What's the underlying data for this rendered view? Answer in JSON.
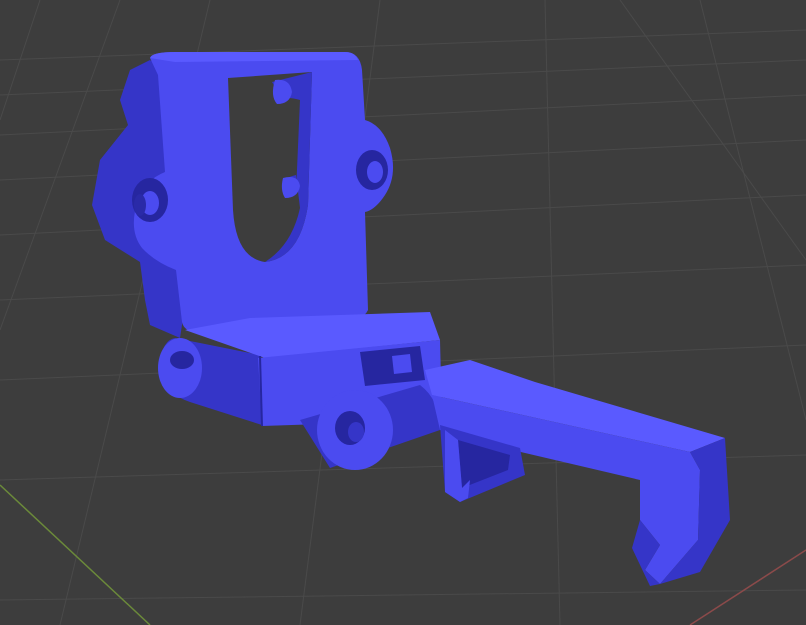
{
  "viewport": {
    "background_color": "#3d3d3d",
    "grid_color": "#4a4a4a",
    "x_axis_color": "#8b4a4a",
    "y_axis_color": "#6b8a3a"
  },
  "model": {
    "material_color": "#4b4bf0",
    "shade_color": "#3535c8",
    "dark_color": "#2626a0",
    "highlight_color": "#5a5aff"
  }
}
